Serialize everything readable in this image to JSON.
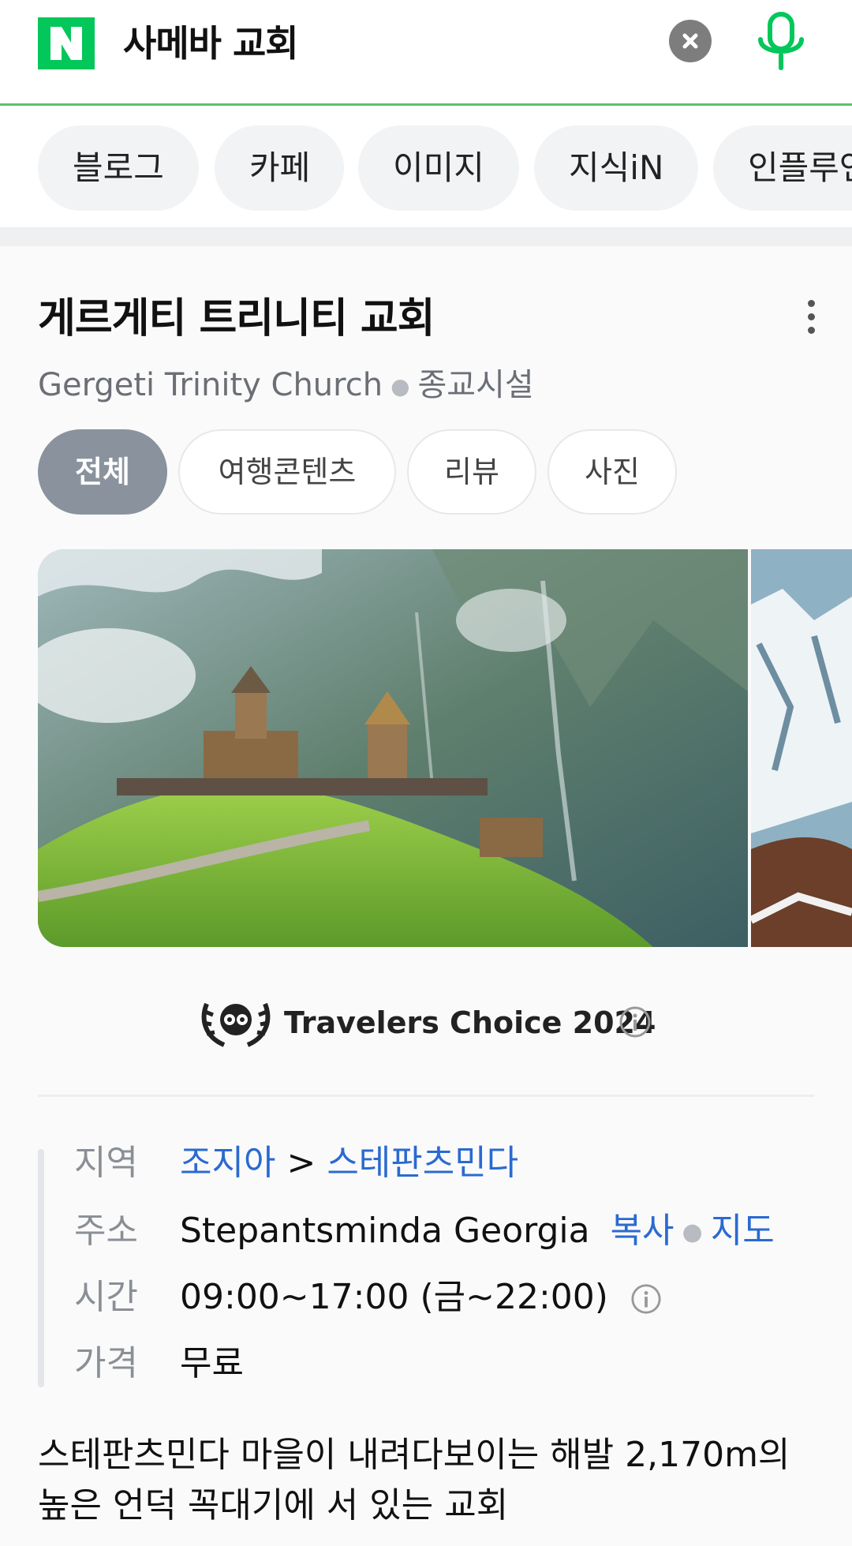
{
  "search": {
    "logo_letter": "N",
    "query": "사메바 교회",
    "brand_color": "#03C75A"
  },
  "tabs": [
    "블로그",
    "카페",
    "이미지",
    "지식iN",
    "인플루언서"
  ],
  "place": {
    "title": "게르게티 트리니티 교회",
    "english_name": "Gergeti Trinity Church",
    "category": "종교시설"
  },
  "content_tabs": [
    "전체",
    "여행콘텐츠",
    "리뷰",
    "사진"
  ],
  "award": {
    "text": "Travelers Choice 2024"
  },
  "info": {
    "region_label": "지역",
    "region_country": "조지아",
    "region_arrow": ">",
    "region_city": "스테판츠민다",
    "address_label": "주소",
    "address_value": "Stepantsminda Georgia",
    "copy_link": "복사",
    "map_link": "지도",
    "hours_label": "시간",
    "hours_value": "09:00~17:00 (금~22:00)",
    "price_label": "가격",
    "price_value": "무료"
  },
  "description": "스테판츠민다 마을이 내려다보이는 해발 2,170m의 높은 언덕 꼭대기에 서 있는 교회"
}
